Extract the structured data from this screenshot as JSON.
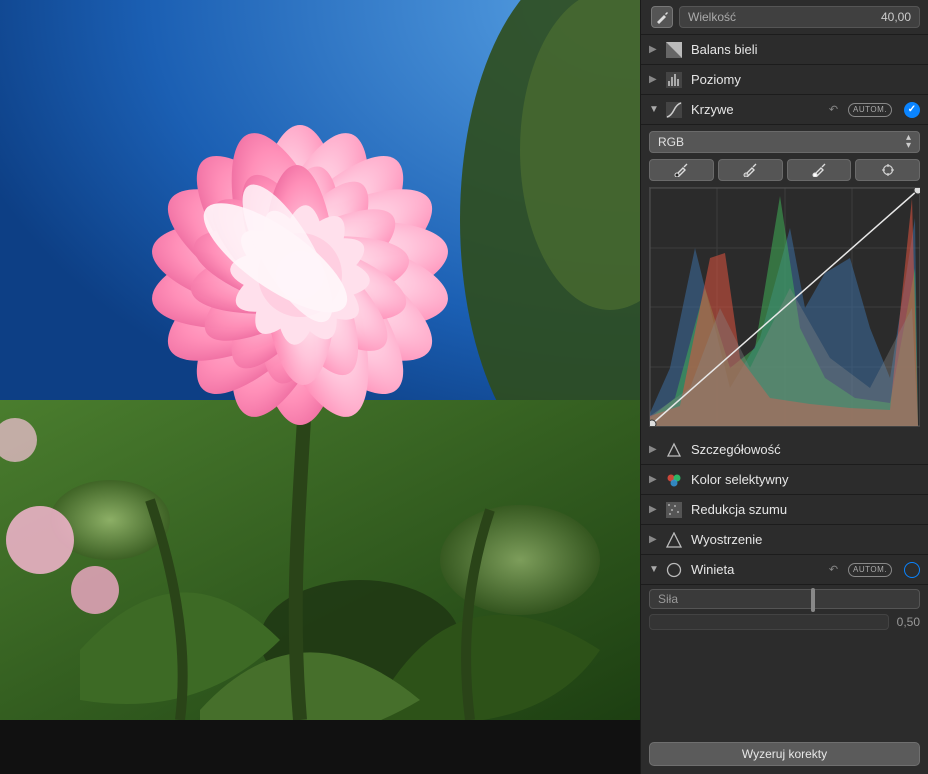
{
  "top_slider": {
    "label": "Wielkość",
    "value": "40,00"
  },
  "sections": {
    "white_balance": "Balans bieli",
    "levels": "Poziomy",
    "curves": "Krzywe",
    "detail": "Szczegółowość",
    "selective_color": "Kolor selektywny",
    "noise_reduction": "Redukcja szumu",
    "sharpening": "Wyostrzenie",
    "vignette": "Winieta"
  },
  "auto_label": "AUTOM.",
  "curves": {
    "channel": "RGB"
  },
  "vignette": {
    "strength_label": "Siła",
    "radius_value": "0,50"
  },
  "reset_button": "Wyzeruj korekty"
}
